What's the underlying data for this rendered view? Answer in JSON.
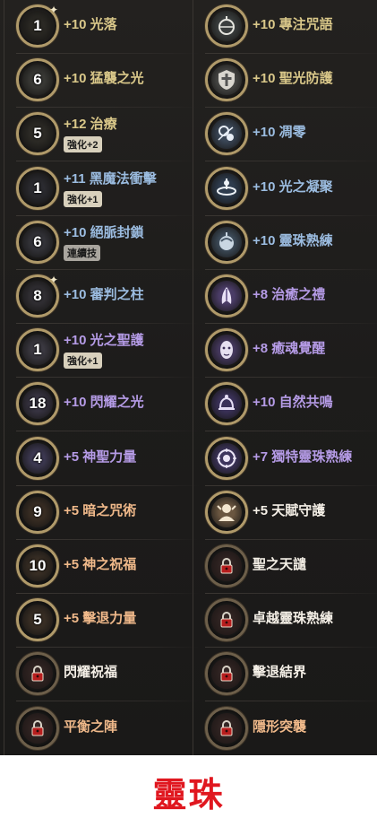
{
  "left_column": [
    {
      "level": "1",
      "name": "+10 光落",
      "color": "yellow",
      "spark": true
    },
    {
      "level": "6",
      "name": "+10 猛襲之光",
      "color": "yellow"
    },
    {
      "level": "5",
      "name": "+12 治療",
      "color": "yellow",
      "badge": "強化+2"
    },
    {
      "level": "1",
      "name": "+11 黑魔法衝擊",
      "color": "blue",
      "badge": "強化+1"
    },
    {
      "level": "6",
      "name": "+10 絕脈封鎖",
      "color": "blue",
      "badge": "連續技",
      "badge_style": "muted"
    },
    {
      "level": "8",
      "name": "+10 審判之柱",
      "color": "blue",
      "spark": true
    },
    {
      "level": "1",
      "name": "+10 光之聖護",
      "color": "purple",
      "badge": "強化+1"
    },
    {
      "level": "18",
      "name": "+10 閃耀之光",
      "color": "purple"
    },
    {
      "level": "4",
      "name": "+5 神聖力量",
      "color": "purple"
    },
    {
      "level": "9",
      "name": "+5 暗之咒術",
      "color": "orange"
    },
    {
      "level": "10",
      "name": "+5 神之祝福",
      "color": "orange"
    },
    {
      "level": "5",
      "name": "+5 擊退力量",
      "color": "orange"
    },
    {
      "level": "",
      "name": "閃耀祝福",
      "color": "white",
      "locked": true
    },
    {
      "level": "",
      "name": "平衡之陣",
      "color": "orange",
      "locked": true
    }
  ],
  "right_column": [
    {
      "name": "+10 專注咒語",
      "color": "yellow",
      "icon": "orb-icon"
    },
    {
      "name": "+10 聖光防護",
      "color": "yellow",
      "icon": "shield-cross-icon"
    },
    {
      "name": "+10 凋零",
      "color": "blue",
      "icon": "wither-icon"
    },
    {
      "name": "+10 光之凝聚",
      "color": "blue",
      "icon": "light-gather-icon"
    },
    {
      "name": "+10 靈珠熟練",
      "color": "blue",
      "icon": "orb-mastery-icon"
    },
    {
      "name": "+8 治癒之禮",
      "color": "purple",
      "icon": "praying-hands-icon"
    },
    {
      "name": "+8 癒魂覺醒",
      "color": "purple",
      "icon": "awaken-face-icon"
    },
    {
      "name": "+10 自然共鳴",
      "color": "purple",
      "icon": "nature-bell-icon"
    },
    {
      "name": "+7 獨特靈珠熟練",
      "color": "purple",
      "icon": "unique-orb-icon"
    },
    {
      "name": "+5 天賦守護",
      "color": "white",
      "icon": "guardian-icon"
    },
    {
      "name": "聖之天譴",
      "color": "white",
      "locked": true
    },
    {
      "name": "卓越靈珠熟練",
      "color": "white",
      "locked": true
    },
    {
      "name": "擊退結界",
      "color": "white",
      "locked": true
    },
    {
      "name": "隱形突襲",
      "color": "orange",
      "locked": true
    }
  ],
  "footer_label": "靈珠",
  "colors": {
    "yellow": "#d9c789",
    "blue": "#9bbce0",
    "purple": "#b59be6",
    "orange": "#f0b98a",
    "white": "#f4efe6",
    "footer": "#e0171f"
  }
}
